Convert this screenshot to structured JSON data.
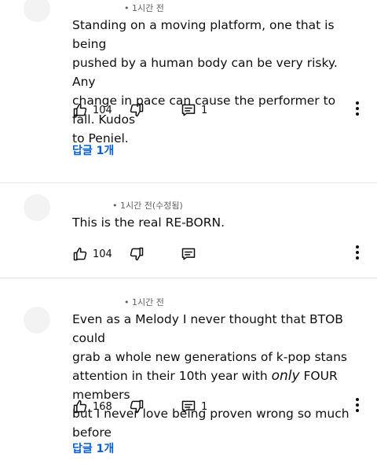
{
  "comments": [
    {
      "meta": "• 1시간 전",
      "lines": [
        "Standing on a moving platform, one that is being",
        "pushed by a human body can be very risky. Any",
        "change in pace can cause the performer to fall. Kudos",
        "to Peniel."
      ],
      "likes": "104",
      "reply_count": "1",
      "replies_label": "답글 1개"
    },
    {
      "meta": "• 1시간 전(수정됨)",
      "lines": [
        "This is the real RE-BORN."
      ],
      "likes": "104"
    },
    {
      "meta": "• 1시간 전",
      "lines": [
        "Even as a Melody I never thought that BTOB could",
        "grab a whole new generations of k-pop stans",
        "FOUR members",
        "but I never love being proven wrong so much before"
      ],
      "line3_prefix": "attention in their 10th year with ",
      "line3_em": "only",
      "likes": "168",
      "reply_count": "1",
      "replies_label": "답글 1개"
    }
  ],
  "icons": [
    "like-icon",
    "dislike-icon",
    "reply-icon",
    "more-options-icon"
  ],
  "colors": {
    "link": "#065fd4",
    "meta": "#606060",
    "text": "#0f0f0f"
  }
}
